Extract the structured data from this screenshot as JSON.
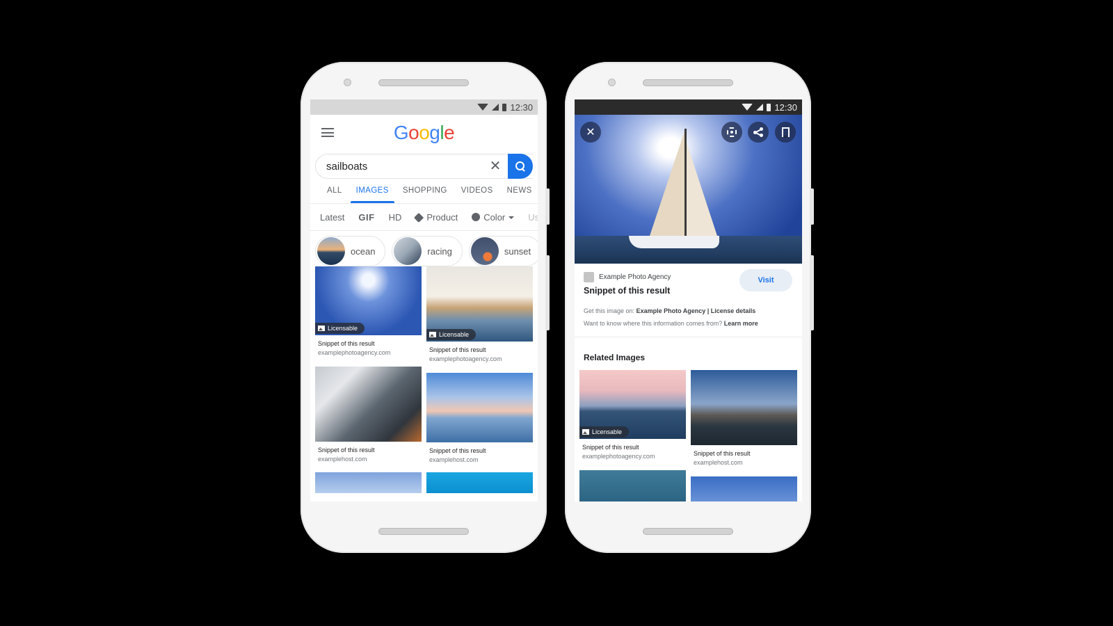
{
  "status_bar": {
    "time": "12:30"
  },
  "left_phone": {
    "logo_letters": [
      "G",
      "o",
      "o",
      "g",
      "l",
      "e"
    ],
    "search": {
      "query": "sailboats",
      "clear_icon": "close-icon",
      "search_icon": "search-icon"
    },
    "tabs": [
      {
        "label": "ALL",
        "active": false
      },
      {
        "label": "IMAGES",
        "active": true
      },
      {
        "label": "SHOPPING",
        "active": false
      },
      {
        "label": "VIDEOS",
        "active": false
      },
      {
        "label": "NEWS",
        "active": false
      }
    ],
    "filters": [
      {
        "label": "Latest"
      },
      {
        "label": "GIF"
      },
      {
        "label": "HD"
      },
      {
        "label": "Product",
        "icon": "tag-icon"
      },
      {
        "label": "Color",
        "icon": "palette-icon",
        "dropdown": true
      },
      {
        "label": "Us"
      }
    ],
    "chips": [
      {
        "label": "ocean"
      },
      {
        "label": "racing"
      },
      {
        "label": "sunset"
      }
    ],
    "results": [
      {
        "caption": "Snippet of this result",
        "host": "examplephotoagency.com",
        "badge": "Licensable"
      },
      {
        "caption": "Snippet of this result",
        "host": "examplephotoagency.com",
        "badge": "Licensable"
      },
      {
        "caption": "Snippet of this result",
        "host": "examplehost.com",
        "badge": null
      },
      {
        "caption": "Snippet of this result",
        "host": "examplehost.com",
        "badge": null
      }
    ]
  },
  "right_phone": {
    "toolbar": {
      "close": "close-icon",
      "lens": "lens-icon",
      "share": "share-icon",
      "save": "bookmark-icon"
    },
    "source": {
      "agency": "Example Photo Agency",
      "title": "Snippet of this result",
      "visit_label": "Visit",
      "get_image_prefix": "Get this image on:",
      "get_image_source": "Example Photo Agency | License details",
      "info_question": "Want to know where this information comes from?",
      "learn_more": "Learn more"
    },
    "related": {
      "title": "Related Images",
      "items": [
        {
          "caption": "Snippet of this result",
          "host": "examplephotoagency.com",
          "badge": "Licensable"
        },
        {
          "caption": "Snippet of this result",
          "host": "examplehost.com",
          "badge": null
        }
      ]
    }
  }
}
